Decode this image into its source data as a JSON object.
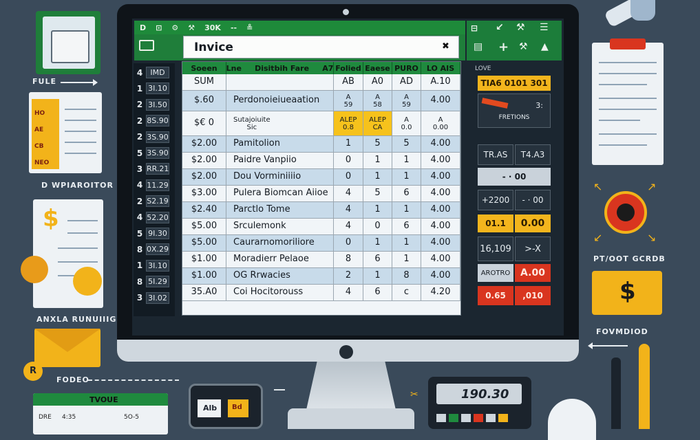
{
  "spreadsheet": {
    "toolbar": [
      "D",
      "⊡",
      "⚙",
      "⚒",
      "30K",
      "--",
      "≗"
    ],
    "title": "Invice",
    "title_icon": "close-icon",
    "ribbon_icons": [
      "chart-icon",
      "plus-icon",
      "tools-icon",
      "stack-icon"
    ],
    "headers": [
      "Soeen",
      "Lne     Disitbih Fare     A7",
      "Folied",
      "Eaese",
      "PURO",
      "LO AIS"
    ],
    "row_numbers": [
      {
        "n": "4",
        "code": "IMD"
      },
      {
        "n": "1",
        "code": "3I.10"
      },
      {
        "n": "2",
        "code": "3I.50"
      },
      {
        "n": "2",
        "code": "8S.90"
      },
      {
        "n": "2",
        "code": "3S.90"
      },
      {
        "n": "5",
        "code": "3S.90"
      },
      {
        "n": "3",
        "code": "RR.21"
      },
      {
        "n": "4",
        "code": "11.29"
      },
      {
        "n": "2",
        "code": "S2.19"
      },
      {
        "n": "4",
        "code": "52.20"
      },
      {
        "n": "5",
        "code": "9I.30"
      },
      {
        "n": "8",
        "code": "0X.29"
      },
      {
        "n": "1",
        "code": "3I.10"
      },
      {
        "n": "8",
        "code": "5I.29"
      },
      {
        "n": "3",
        "code": "3I.02"
      }
    ],
    "rows": [
      {
        "a": "SUM",
        "b": "",
        "c": "AB",
        "d": "A0",
        "e": "AD",
        "f": "A.10"
      },
      {
        "a": "$.60",
        "b": "Perdonoieiueaation",
        "c": "A\n59",
        "d": "A\n58",
        "e": "A\n59",
        "f": "4.00"
      },
      {
        "a": "$€ 0",
        "b": "Sutajoiuite\nSic",
        "c": "ALEP\n0.8",
        "d": "ALEP\nCA",
        "e": "A\n0.0",
        "f": "A\n0.00"
      },
      {
        "a": "$2.00",
        "b": "Pamitolion",
        "c": "1",
        "d": "5",
        "e": "5",
        "f": "4.00"
      },
      {
        "a": "$2.00",
        "b": "Paidre Vanpiio",
        "c": "0",
        "d": "1",
        "e": "1",
        "f": "4.00"
      },
      {
        "a": "$2.00",
        "b": "Dou Vorminiiiio",
        "c": "0",
        "d": "1",
        "e": "1",
        "f": "4.00"
      },
      {
        "a": "$3.00",
        "b": "Pulera Biomcan Aiioe",
        "c": "4",
        "d": "5",
        "e": "6",
        "f": "4.00"
      },
      {
        "a": "$2.40",
        "b": "Parctlo Tome",
        "c": "4",
        "d": "1",
        "e": "1",
        "f": "4.00"
      },
      {
        "a": "$5.00",
        "b": "Srculemonk",
        "c": "4",
        "d": "0",
        "e": "6",
        "f": "4.00"
      },
      {
        "a": "$5.00",
        "b": "Caurarnomoriliore",
        "c": "0",
        "d": "1",
        "e": "1",
        "f": "4.00"
      },
      {
        "a": "$1.00",
        "b": "Moradierr Pelaoe",
        "c": "8",
        "d": "6",
        "e": "1",
        "f": "4.00"
      },
      {
        "a": "$1.00",
        "b": "OG Rrwacies",
        "c": "2",
        "d": "1",
        "e": "8",
        "f": "4.00"
      },
      {
        "a": "35.A0",
        "b": "Coi Hocitorouss",
        "c": "4",
        "d": "6",
        "e": "c",
        "f": "4.20"
      }
    ]
  },
  "right_panel": {
    "label": "LOVE",
    "top_bar": "TIA6  0101  301",
    "fraction_label": "FRETIONS",
    "fraction_val": "3:",
    "tras": "TR.AS",
    "tr_val": "T4.A3",
    "minus": "- · 00",
    "plus_val": "+2200",
    "minus_val": "- · 00",
    "row_y": "01.1",
    "row_y_val": "0.00",
    "n1": "16,109",
    "n1_op": ">-X",
    "aroto": "AROTRO",
    "aroto_val": "A.00",
    "red1": "0.65",
    "red2": ",010"
  },
  "props": {
    "file_label": "FULE",
    "dep_label": "D WPIAROITOR",
    "anxla_label": "ANXLA RUNUIIIG",
    "fodeo_label": "FODEO",
    "pivot_label": "PT/OOT GCRDB",
    "fovmdiod_label": "FOVMDIOD",
    "tvoue_label": "TVOUE",
    "calc_display": "190.30",
    "phone_ab": "Alb",
    "phone_bd": "Bd",
    "card_rows": [
      "HO",
      "AE",
      "CB",
      "NEO"
    ],
    "bottom_doc_left": "DRE",
    "bottom_doc_val1": "4:35",
    "bottom_doc_val2": "5O-5",
    "dollar": "$",
    "coin_letter": "R"
  },
  "colors": {
    "background": "#3a4a5a",
    "green": "#1f8a3e",
    "yellow": "#f3b51d",
    "red": "#d9351f"
  }
}
